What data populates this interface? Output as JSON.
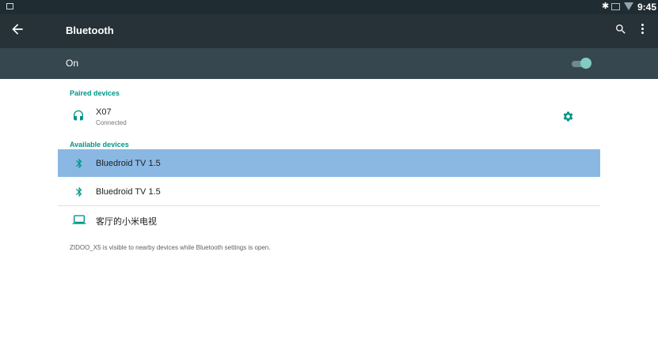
{
  "status_bar": {
    "time": "9:45",
    "icons": [
      "notification-icon",
      "bluetooth-icon",
      "ethernet-icon",
      "wifi-icon"
    ]
  },
  "toolbar": {
    "title": "Bluetooth",
    "icons": [
      "back-arrow-icon",
      "search-icon",
      "more-vert-icon"
    ]
  },
  "master_switch": {
    "label": "On",
    "checked": true
  },
  "paired": {
    "header": "Paired devices",
    "devices": [
      {
        "name": "X07",
        "summary": "Connected",
        "icon": "headset-icon",
        "action_icon": "gear-icon"
      }
    ]
  },
  "available": {
    "header": "Available devices",
    "devices": [
      {
        "name": "Bluedroid TV 1.5",
        "icon": "bluetooth-icon",
        "selected": true
      },
      {
        "name": "Bluedroid TV 1.5",
        "icon": "bluetooth-icon",
        "selected": false
      },
      {
        "name": "客厅的小米电视",
        "icon": "laptop-icon",
        "selected": false
      }
    ]
  },
  "footer_text": "ZIDOO_X5 is visible to nearby devices while Bluetooth settings is open.",
  "colors": {
    "accent": "#009688",
    "toolbar": "#263238",
    "status_bar": "#1f2c32",
    "master_bar": "#37474f",
    "selected_row": "#8ab8e3"
  }
}
